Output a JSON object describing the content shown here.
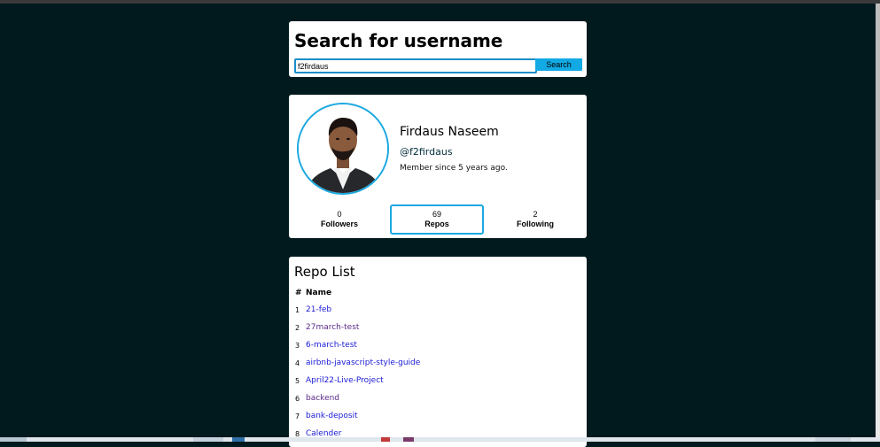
{
  "search": {
    "title": "Search for username",
    "input_value": "f2firdaus",
    "button_label": "Search"
  },
  "profile": {
    "name": "Firdaus Naseem",
    "handle": "@f2firdaus",
    "member_since": "Member since 5 years ago.",
    "stats": {
      "followers": {
        "value": "0",
        "label": "Followers"
      },
      "repos": {
        "value": "69",
        "label": "Repos"
      },
      "following": {
        "value": "2",
        "label": "Following"
      }
    }
  },
  "repo_list": {
    "title": "Repo List",
    "columns": {
      "index": "#",
      "name": "Name"
    },
    "rows": [
      {
        "index": "1",
        "name": "21-feb",
        "visited": false
      },
      {
        "index": "2",
        "name": "27march-test",
        "visited": true
      },
      {
        "index": "3",
        "name": "6-march-test",
        "visited": false
      },
      {
        "index": "4",
        "name": "airbnb-javascript-style-guide",
        "visited": false
      },
      {
        "index": "5",
        "name": "April22-Live-Project",
        "visited": false
      },
      {
        "index": "6",
        "name": "backend",
        "visited": true
      },
      {
        "index": "7",
        "name": "bank-deposit",
        "visited": false
      },
      {
        "index": "8",
        "name": "Calender",
        "visited": false
      }
    ]
  },
  "colors": {
    "page_background": "#001a1e",
    "accent": "#1aa8e0",
    "search_button": "#12a9e4",
    "link": "#1a1ad6",
    "link_visited": "#5a2a86"
  }
}
